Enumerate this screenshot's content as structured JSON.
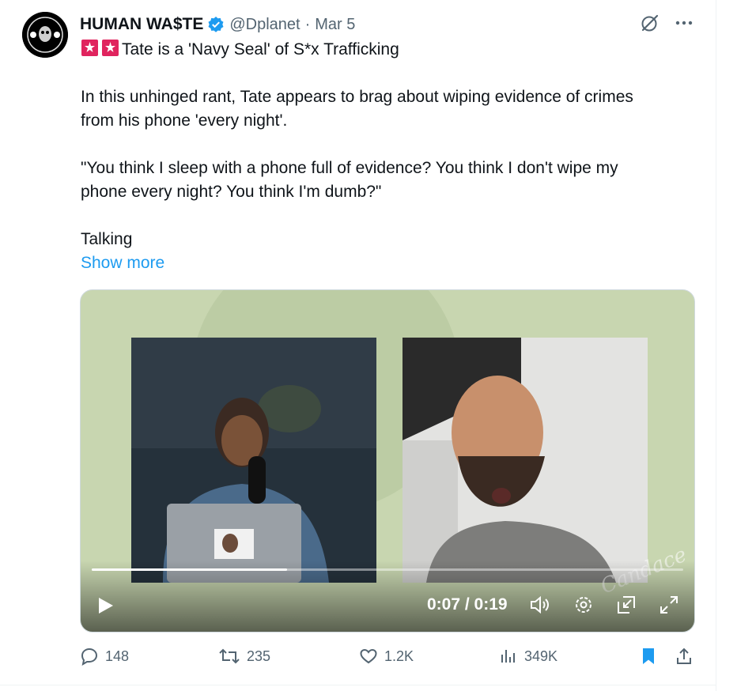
{
  "tweet": {
    "author_name": "HUMAN WA$TE",
    "handle": "@Dplanet",
    "separator": "·",
    "date": "Mar 5",
    "line1": "Tate is a 'Navy Seal' of S*x Trafficking",
    "line2": "In this unhinged rant, Tate appears to brag about wiping evidence of crimes",
    "line3": "from his phone 'every night'.",
    "line4": "\"You think I sleep with a phone full of evidence? You think I don't wipe my",
    "line5": "phone every night? You think I'm dumb?\"",
    "line6": "Talking",
    "show_more": "Show more"
  },
  "video": {
    "time": "0:07 / 0:19",
    "progress": 0.33,
    "watermark": "Candace"
  },
  "actions": {
    "replies": "148",
    "reposts": "235",
    "likes": "1.2K",
    "views": "349K"
  },
  "colors": {
    "accent": "#1d9bf0",
    "secondary_text": "#536471",
    "siren": "#e0245e"
  }
}
